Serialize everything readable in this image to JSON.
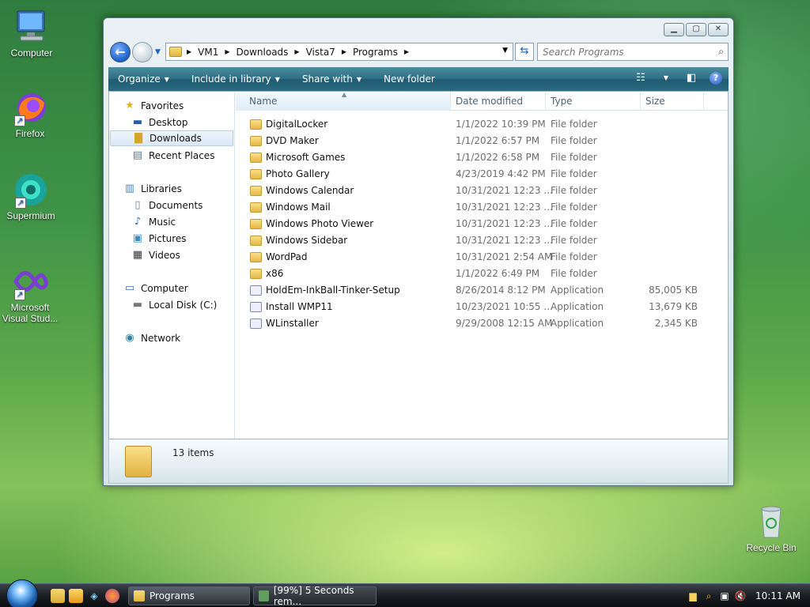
{
  "desktop": {
    "icons": [
      {
        "label": "Computer"
      },
      {
        "label": "Firefox"
      },
      {
        "label": "Supermium"
      },
      {
        "label": "Microsoft Visual Stud..."
      },
      {
        "label": "Recycle Bin"
      }
    ]
  },
  "window": {
    "address": {
      "crumbs": [
        "VM1",
        "Downloads",
        "Vista7",
        "Programs"
      ]
    },
    "search": {
      "placeholder": "Search Programs"
    },
    "toolbar": {
      "organize": "Organize",
      "include": "Include in library",
      "share": "Share with",
      "new_folder": "New folder"
    },
    "nav": {
      "favorites": "Favorites",
      "desktop": "Desktop",
      "downloads": "Downloads",
      "recent": "Recent Places",
      "libraries": "Libraries",
      "documents": "Documents",
      "music": "Music",
      "pictures": "Pictures",
      "videos": "Videos",
      "computer": "Computer",
      "local_disk": "Local Disk (C:)",
      "network": "Network"
    },
    "columns": {
      "name": "Name",
      "date": "Date modified",
      "type": "Type",
      "size": "Size"
    },
    "files": [
      {
        "name": "DigitalLocker",
        "date": "1/1/2022 10:39 PM",
        "type": "File folder",
        "size": "",
        "kind": "folder"
      },
      {
        "name": "DVD Maker",
        "date": "1/1/2022 6:57 PM",
        "type": "File folder",
        "size": "",
        "kind": "folder"
      },
      {
        "name": "Microsoft Games",
        "date": "1/1/2022 6:58 PM",
        "type": "File folder",
        "size": "",
        "kind": "folder"
      },
      {
        "name": "Photo Gallery",
        "date": "4/23/2019 4:42 PM",
        "type": "File folder",
        "size": "",
        "kind": "folder"
      },
      {
        "name": "Windows Calendar",
        "date": "10/31/2021 12:23 ...",
        "type": "File folder",
        "size": "",
        "kind": "folder"
      },
      {
        "name": "Windows Mail",
        "date": "10/31/2021 12:23 ...",
        "type": "File folder",
        "size": "",
        "kind": "folder"
      },
      {
        "name": "Windows Photo Viewer",
        "date": "10/31/2021 12:23 ...",
        "type": "File folder",
        "size": "",
        "kind": "folder"
      },
      {
        "name": "Windows Sidebar",
        "date": "10/31/2021 12:23 ...",
        "type": "File folder",
        "size": "",
        "kind": "folder"
      },
      {
        "name": "WordPad",
        "date": "10/31/2021 2:54 AM",
        "type": "File folder",
        "size": "",
        "kind": "folder"
      },
      {
        "name": "x86",
        "date": "1/1/2022 6:49 PM",
        "type": "File folder",
        "size": "",
        "kind": "folder"
      },
      {
        "name": "HoldEm-InkBall-Tinker-Setup",
        "date": "8/26/2014 8:12 PM",
        "type": "Application",
        "size": "85,005 KB",
        "kind": "app"
      },
      {
        "name": "Install WMP11",
        "date": "10/23/2021 10:55 ...",
        "type": "Application",
        "size": "13,679 KB",
        "kind": "app"
      },
      {
        "name": "WLinstaller",
        "date": "9/29/2008 12:15 AM",
        "type": "Application",
        "size": "2,345 KB",
        "kind": "app"
      }
    ],
    "status": {
      "items_count": "13 items"
    }
  },
  "taskbar": {
    "buttons": [
      {
        "label": "Programs"
      },
      {
        "label": "[99%] 5 Seconds rem..."
      }
    ],
    "clock": "10:11 AM"
  }
}
